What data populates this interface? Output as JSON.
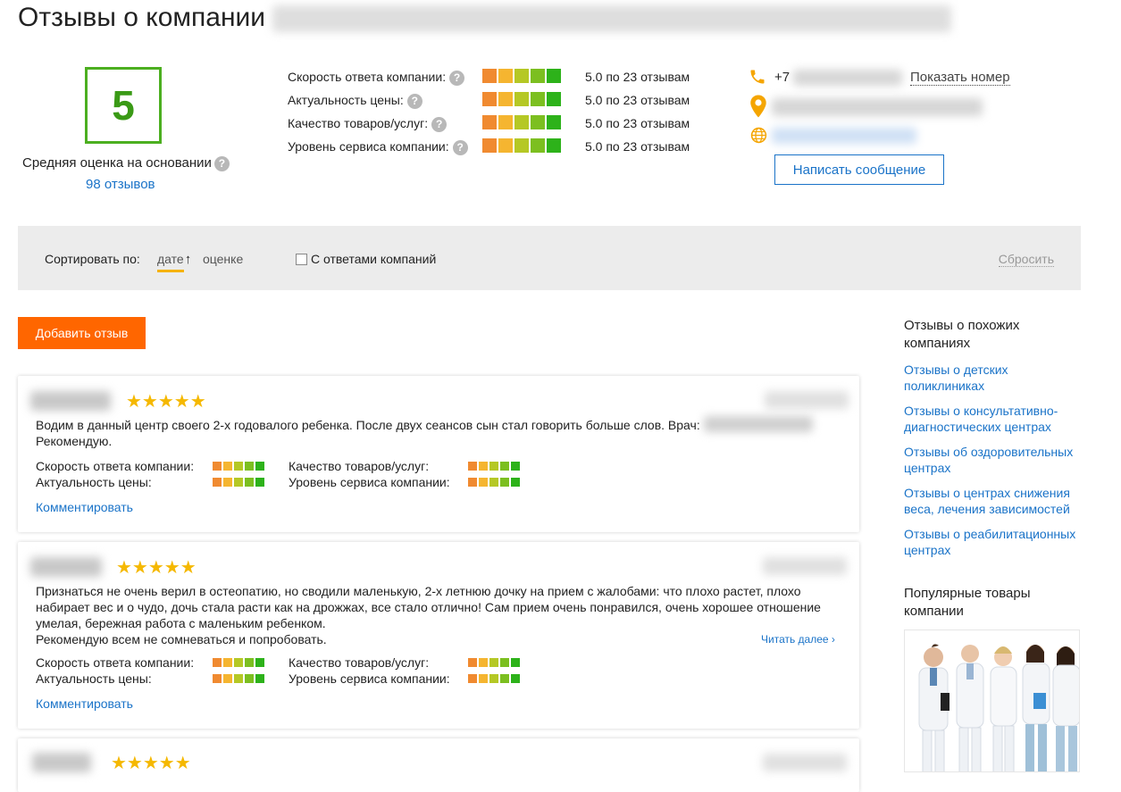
{
  "page_title": "Отзывы о компании",
  "summary": {
    "score": "5",
    "avg_label": "Средняя оценка на основании",
    "reviews_count": "98 отзывов"
  },
  "criteria": [
    {
      "label": "Скорость ответа компании:",
      "value": "5.0 по 23 отзывам",
      "rating": 5
    },
    {
      "label": "Актуальность цены:",
      "value": "5.0 по 23 отзывам",
      "rating": 5
    },
    {
      "label": "Качество товаров/услуг:",
      "value": "5.0 по 23 отзывам",
      "rating": 5
    },
    {
      "label": "Уровень сервиса компании:",
      "value": "5.0 по 23 отзывам",
      "rating": 5
    }
  ],
  "contacts": {
    "phone_prefix": "+7",
    "show_number": "Показать номер",
    "message_button": "Написать сообщение"
  },
  "sort": {
    "label": "Сортировать по:",
    "by_date": "дате",
    "by_rating": "оценке",
    "with_replies": "С ответами компаний",
    "reset": "Сбросить"
  },
  "add_review": "Добавить отзыв",
  "reviews": [
    {
      "stars": "★★★★★",
      "text_before": "Водим в данный центр своего 2-х годовалого ребенка. После двух сеансов сын стал говорить больше слов. Врач:",
      "text_after": "Рекомендую.",
      "criteria": {
        "speed": "Скорость ответа компании:",
        "price": "Актуальность цены:",
        "quality": "Качество товаров/услуг:",
        "service": "Уровень сервиса компании:"
      },
      "comment": "Комментировать"
    },
    {
      "stars": "★★★★★",
      "text": "Признаться не очень верил в остеопатию, но сводили маленькую, 2-х летнюю дочку на прием с жалобами: что плохо растет, плохо набирает вес и о чудо, дочь стала расти как на дрожжах, все стало отлично! Сам прием очень понравился, очень хорошее отношение умелая, бережная работа с маленьким ребенком.",
      "text2": "Рекомендую всем не сомневаться и попробовать.",
      "read_more": "Читать далее ›",
      "criteria": {
        "speed": "Скорость ответа компании:",
        "price": "Актуальность цены:",
        "quality": "Качество товаров/услуг:",
        "service": "Уровень сервиса компании:"
      },
      "comment": "Комментировать"
    },
    {
      "stars": "★★★★★"
    }
  ],
  "sidebar": {
    "similar_title": "Отзывы о похожих компаниях",
    "links": [
      "Отзывы о детских поликлиниках",
      "Отзывы о консультативно-диагностических центрах",
      "Отзывы об оздоровительных центрах",
      "Отзывы о центрах снижения веса, лечения зависимостей",
      "Отзывы о реабилитационных центрах"
    ],
    "popular_title": "Популярные товары компании"
  },
  "colors": {
    "accent_orange": "#ff6600",
    "link_blue": "#1a73c8",
    "score_green": "#4caf20",
    "star_yellow": "#f5b800"
  }
}
